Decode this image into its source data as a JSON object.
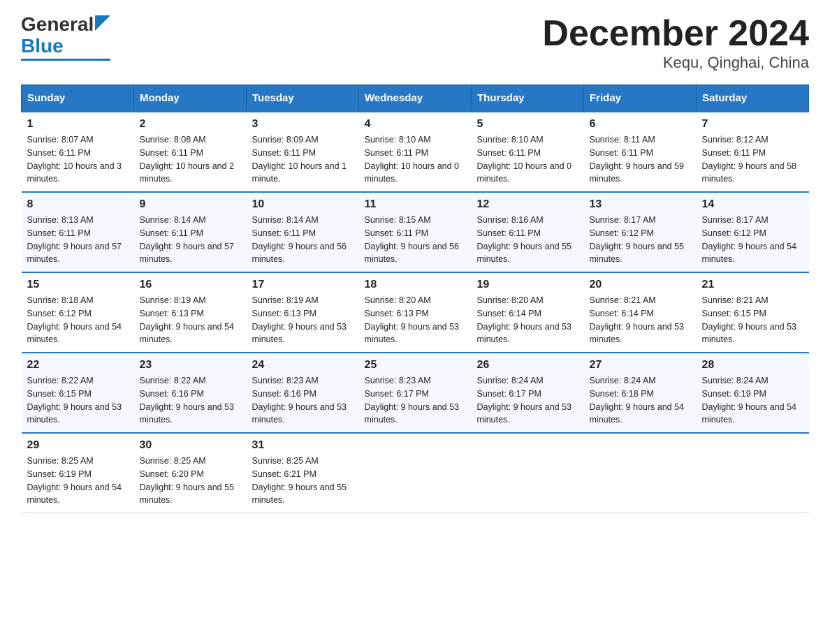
{
  "header": {
    "logo_general": "General",
    "logo_blue": "Blue",
    "title": "December 2024",
    "subtitle": "Kequ, Qinghai, China"
  },
  "days_of_week": [
    "Sunday",
    "Monday",
    "Tuesday",
    "Wednesday",
    "Thursday",
    "Friday",
    "Saturday"
  ],
  "weeks": [
    [
      {
        "day": "1",
        "sunrise": "8:07 AM",
        "sunset": "6:11 PM",
        "daylight": "10 hours and 3 minutes."
      },
      {
        "day": "2",
        "sunrise": "8:08 AM",
        "sunset": "6:11 PM",
        "daylight": "10 hours and 2 minutes."
      },
      {
        "day": "3",
        "sunrise": "8:09 AM",
        "sunset": "6:11 PM",
        "daylight": "10 hours and 1 minute."
      },
      {
        "day": "4",
        "sunrise": "8:10 AM",
        "sunset": "6:11 PM",
        "daylight": "10 hours and 0 minutes."
      },
      {
        "day": "5",
        "sunrise": "8:10 AM",
        "sunset": "6:11 PM",
        "daylight": "10 hours and 0 minutes."
      },
      {
        "day": "6",
        "sunrise": "8:11 AM",
        "sunset": "6:11 PM",
        "daylight": "9 hours and 59 minutes."
      },
      {
        "day": "7",
        "sunrise": "8:12 AM",
        "sunset": "6:11 PM",
        "daylight": "9 hours and 58 minutes."
      }
    ],
    [
      {
        "day": "8",
        "sunrise": "8:13 AM",
        "sunset": "6:11 PM",
        "daylight": "9 hours and 57 minutes."
      },
      {
        "day": "9",
        "sunrise": "8:14 AM",
        "sunset": "6:11 PM",
        "daylight": "9 hours and 57 minutes."
      },
      {
        "day": "10",
        "sunrise": "8:14 AM",
        "sunset": "6:11 PM",
        "daylight": "9 hours and 56 minutes."
      },
      {
        "day": "11",
        "sunrise": "8:15 AM",
        "sunset": "6:11 PM",
        "daylight": "9 hours and 56 minutes."
      },
      {
        "day": "12",
        "sunrise": "8:16 AM",
        "sunset": "6:11 PM",
        "daylight": "9 hours and 55 minutes."
      },
      {
        "day": "13",
        "sunrise": "8:17 AM",
        "sunset": "6:12 PM",
        "daylight": "9 hours and 55 minutes."
      },
      {
        "day": "14",
        "sunrise": "8:17 AM",
        "sunset": "6:12 PM",
        "daylight": "9 hours and 54 minutes."
      }
    ],
    [
      {
        "day": "15",
        "sunrise": "8:18 AM",
        "sunset": "6:12 PM",
        "daylight": "9 hours and 54 minutes."
      },
      {
        "day": "16",
        "sunrise": "8:19 AM",
        "sunset": "6:13 PM",
        "daylight": "9 hours and 54 minutes."
      },
      {
        "day": "17",
        "sunrise": "8:19 AM",
        "sunset": "6:13 PM",
        "daylight": "9 hours and 53 minutes."
      },
      {
        "day": "18",
        "sunrise": "8:20 AM",
        "sunset": "6:13 PM",
        "daylight": "9 hours and 53 minutes."
      },
      {
        "day": "19",
        "sunrise": "8:20 AM",
        "sunset": "6:14 PM",
        "daylight": "9 hours and 53 minutes."
      },
      {
        "day": "20",
        "sunrise": "8:21 AM",
        "sunset": "6:14 PM",
        "daylight": "9 hours and 53 minutes."
      },
      {
        "day": "21",
        "sunrise": "8:21 AM",
        "sunset": "6:15 PM",
        "daylight": "9 hours and 53 minutes."
      }
    ],
    [
      {
        "day": "22",
        "sunrise": "8:22 AM",
        "sunset": "6:15 PM",
        "daylight": "9 hours and 53 minutes."
      },
      {
        "day": "23",
        "sunrise": "8:22 AM",
        "sunset": "6:16 PM",
        "daylight": "9 hours and 53 minutes."
      },
      {
        "day": "24",
        "sunrise": "8:23 AM",
        "sunset": "6:16 PM",
        "daylight": "9 hours and 53 minutes."
      },
      {
        "day": "25",
        "sunrise": "8:23 AM",
        "sunset": "6:17 PM",
        "daylight": "9 hours and 53 minutes."
      },
      {
        "day": "26",
        "sunrise": "8:24 AM",
        "sunset": "6:17 PM",
        "daylight": "9 hours and 53 minutes."
      },
      {
        "day": "27",
        "sunrise": "8:24 AM",
        "sunset": "6:18 PM",
        "daylight": "9 hours and 54 minutes."
      },
      {
        "day": "28",
        "sunrise": "8:24 AM",
        "sunset": "6:19 PM",
        "daylight": "9 hours and 54 minutes."
      }
    ],
    [
      {
        "day": "29",
        "sunrise": "8:25 AM",
        "sunset": "6:19 PM",
        "daylight": "9 hours and 54 minutes."
      },
      {
        "day": "30",
        "sunrise": "8:25 AM",
        "sunset": "6:20 PM",
        "daylight": "9 hours and 55 minutes."
      },
      {
        "day": "31",
        "sunrise": "8:25 AM",
        "sunset": "6:21 PM",
        "daylight": "9 hours and 55 minutes."
      },
      null,
      null,
      null,
      null
    ]
  ],
  "labels": {
    "sunrise": "Sunrise:",
    "sunset": "Sunset:",
    "daylight": "Daylight:"
  }
}
